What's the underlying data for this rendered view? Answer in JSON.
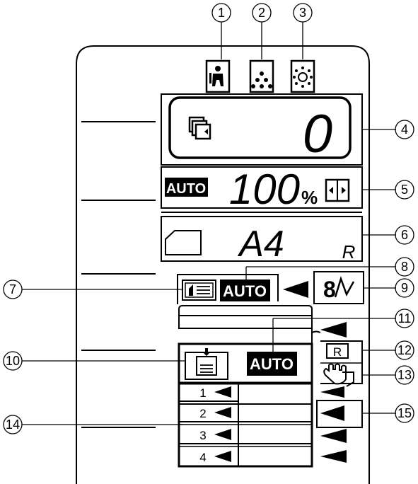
{
  "callouts": {
    "c1": "1",
    "c2": "2",
    "c3": "3",
    "c4": "4",
    "c5": "5",
    "c6": "6",
    "c7": "7",
    "c8": "8",
    "c9": "9",
    "c10": "10",
    "c11": "11",
    "c12": "12",
    "c13": "13",
    "c14": "14",
    "c15": "15"
  },
  "display": {
    "copy_count": "0",
    "auto_ratio_badge": "AUTO",
    "ratio": "100",
    "percent": "%",
    "paper_size": "A4",
    "paper_rotation": "R",
    "exposure_auto_badge": "AUTO",
    "tray_auto_badge": "AUTO",
    "reserve_letter": "R"
  },
  "trays": [
    "1",
    "2",
    "3",
    "4"
  ]
}
